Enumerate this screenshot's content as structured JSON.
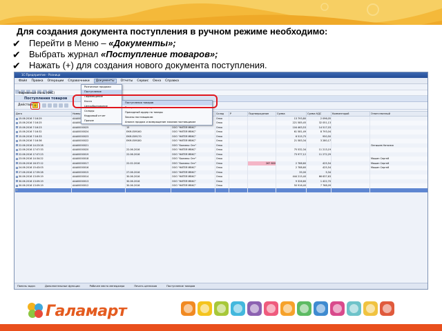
{
  "instructions": {
    "heading": "Для создания документа поступления в ручном режиме необходимо:",
    "steps": [
      {
        "prefix": "Перейти в Меню – ",
        "emph": "«Документы»;",
        "suffix": ""
      },
      {
        "prefix": "Выбрать журнал ",
        "emph": "«Поступление товаров»;",
        "suffix": ""
      },
      {
        "prefix": "Нажать (+) для создания нового документа поступления.",
        "emph": "",
        "suffix": ""
      }
    ]
  },
  "window": {
    "title": "1С:Предприятие - Розница",
    "menu": [
      "Файл",
      "Правка",
      "Операции",
      "Справочники",
      "Документы",
      "Отчеты",
      "Сервис",
      "Окна",
      "Справка"
    ],
    "active_menu": "Документы",
    "interface_label": "Фирменный стиль (ФНС)",
    "doc_title": "Поступления товаров",
    "actions_label": "Действия",
    "columns": [
      "Дата",
      "Номер",
      "Вх. номер",
      "Контрагент",
      "Склад",
      "Р",
      "Подтверждение",
      "Сумма",
      "Сумма НДС",
      "Комментарий",
      "Ответственный"
    ],
    "rows": [
      {
        "date": "15.06.2016 7:16:29",
        "num": "AAAI0000027",
        "in": "15",
        "ka": "ООО \"НИТЕЯ МВКС\"",
        "sk": "Онко",
        "confirm": "",
        "sum": "13 793,80",
        "nds": "2 096,05",
        "comm": "",
        "resp": "",
        "pink": false
      },
      {
        "date": "15.06.2016 7:16:25",
        "num": "AAAI0000026",
        "in": "15",
        "ka": "ООО \"НИТЕЯ МВКС\"",
        "sk": "Онко",
        "confirm": "",
        "sum": "221 585,45",
        "nds": "32 051,13",
        "comm": "",
        "resp": "",
        "pink": false
      },
      {
        "date": "15.06.2016 7:16:23",
        "num": "AAAI0000025",
        "in": "15",
        "ka": "ООО \"НИТЕЯ МВКС\"",
        "sk": "Онко",
        "confirm": "",
        "sum": "104 463,53",
        "nds": "14 517,03",
        "comm": "",
        "resp": "",
        "pink": false
      },
      {
        "date": "15.06.2016 7:16:32",
        "num": "AAAI0000024",
        "in": "ЕКМ-Е09160",
        "ka": "ООО \"НИТЕЯ МВКС\"",
        "sk": "Онко",
        "confirm": "",
        "sum": "61 581,49",
        "nds": "8 793,04",
        "comm": "",
        "resp": "",
        "pink": false
      },
      {
        "date": "15.06.2016 7:16:33",
        "num": "AAAI0000023",
        "in": "ЕКМ-Е09170",
        "ka": "ООО \"НИТЕЯ МВКС\"",
        "sk": "Онко",
        "confirm": "",
        "sum": "6 515,75",
        "nds": "950,50",
        "comm": "",
        "resp": "",
        "pink": false
      },
      {
        "date": "15.06.2016 7:16:36",
        "num": "AAAI0000022",
        "in": "ЕКМ-Е09180",
        "ka": "ООО \"НИТЕЯ МВКС\"",
        "sk": "Онко",
        "confirm": "",
        "sum": "21 583,34",
        "nds": "3 280,17",
        "comm": "",
        "resp": "",
        "pink": false
      },
      {
        "date": "22.06.2016 14:23:28",
        "num": "AAAI0000021",
        "in": "",
        "ka": "ООО \"Холмекс Опт\"",
        "sk": "Онко",
        "confirm": "",
        "sum": "",
        "nds": "",
        "comm": "",
        "resp": "Латышев Наталия",
        "pink": false
      },
      {
        "date": "22.06.2016 17:07:33",
        "num": "AAAI0000020",
        "in": "22.06.2016",
        "ka": "ООО \"НИТЕЯ МВКС\"",
        "sk": "Онко",
        "confirm": "",
        "sum": "75 532,34",
        "nds": "11 213,19",
        "comm": "",
        "resp": "",
        "pink": false
      },
      {
        "date": "22.06.2016 17:07:23",
        "num": "AAAI0000019",
        "in": "22.06.2016",
        "ka": "ООО \"НИТЕЯ МВКС\"",
        "sk": "Онко",
        "confirm": "",
        "sum": "73 977,12",
        "nds": "11 272,29",
        "comm": "",
        "resp": "",
        "pink": false
      },
      {
        "date": "23.06.2016 14:34:22",
        "num": "AAAI0000018",
        "in": "",
        "ka": "ООО \"Холмекс Опт\"",
        "sk": "Онко",
        "confirm": "",
        "sum": "",
        "nds": "",
        "comm": "",
        "resp": "Машин Сергей",
        "pink": false
      },
      {
        "date": "23.06.2016 16:37:12",
        "num": "AAAI0000017",
        "in": "22.02.2016",
        "ka": "ООО \"Холмекс Опт\"",
        "sk": "Онко",
        "confirm": "267 800",
        "sum": "2 788,60",
        "nds": "425,54",
        "comm": "",
        "resp": "Машин Сергей",
        "pink": true
      },
      {
        "date": "24.06.2016 15:43:03",
        "num": "AAAI0000016",
        "in": "",
        "ka": "ООО \"НИТЕЯ МВКС\"",
        "sk": "Онко",
        "confirm": "",
        "sum": "2 788,60",
        "nds": "425,54",
        "comm": "",
        "resp": "Машин Сергей",
        "pink": false
      },
      {
        "date": "27.06.2016 17:59:28",
        "num": "AAAI0000015",
        "in": "27.06.2016",
        "ka": "ООО \"НИТЕЯ МВКС\"",
        "sk": "Онко",
        "confirm": "",
        "sum": "35,00",
        "nds": "5,34",
        "comm": "",
        "resp": "",
        "pink": false
      },
      {
        "date": "30.06.2016 13:09:19",
        "num": "AAAI0000014",
        "in": "30.06.2016",
        "ka": "ООО \"НИТЕЯ МВКС\"",
        "sk": "Онко",
        "confirm": "",
        "sum": "444 215,40",
        "nds": "66 637,63",
        "comm": "",
        "resp": "",
        "pink": false
      },
      {
        "date": "30.06.2016 13:09:19",
        "num": "AAAI0000013",
        "in": "30.06.2016",
        "ka": "ООО \"НИТЕЯ МВКС\"",
        "sk": "Онко",
        "confirm": "",
        "sum": "9 326,60",
        "nds": "1 422,70",
        "comm": "",
        "resp": "",
        "pink": false
      },
      {
        "date": "30.06.2016 13:09:19",
        "num": "AAAI0000012",
        "in": "30.06.2016",
        "ka": "ООО \"НИТЕЯ МВКС\"",
        "sk": "Онко",
        "confirm": "",
        "sum": "50 916,40",
        "nds": "7 768,09",
        "comm": "",
        "resp": "",
        "pink": false
      },
      {
        "date": "",
        "num": "",
        "in": "",
        "ka": "",
        "sk": "",
        "confirm": "",
        "sum": "",
        "nds": "",
        "comm": "",
        "resp": "",
        "pink": false
      }
    ],
    "menu_documents": [
      "Розничные продажи",
      "Поступление",
      "Перемещение",
      "Касса",
      "Ценообразование",
      "Склады",
      "Кадровый отчет",
      "Прочие"
    ],
    "menu_postuplenie": [
      "Поступления товаров",
      "Возврат поставщику",
      "Приходный ордер на товары",
      "Заказы поставщикам",
      "Анализ продаж и возвращение заказов поставщикам"
    ],
    "status_items": [
      "Панель задач",
      "Дополнительные функции",
      "Рабочее место менеджера",
      "Печать ценников",
      "Поступление товаров"
    ]
  },
  "footer": {
    "brand": "Галамарт"
  },
  "colors": {
    "accent_red": "#e0161d",
    "brand_orange": "#e45b1f",
    "banner_yellow": "#f4b93a",
    "badges": [
      "#f18a22",
      "#f4c41e",
      "#a7c839",
      "#43b8dd",
      "#8c62b1",
      "#ef5b7d",
      "#f6a22b",
      "#5dbb63",
      "#3f8bd0",
      "#d94a8c",
      "#6ec3c9",
      "#f0c340",
      "#e05a3c"
    ]
  }
}
